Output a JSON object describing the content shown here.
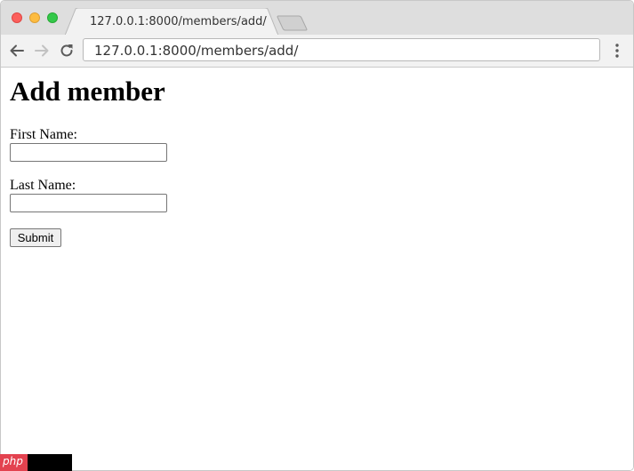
{
  "browser": {
    "tab_title": "127.0.0.1:8000/members/add/",
    "url": "127.0.0.1:8000/members/add/",
    "colors": {
      "close": "#fc605c",
      "minimize": "#fdbc40",
      "maximize": "#34c84a",
      "tabstrip": "#dedede",
      "toolbar": "#f2f2f2"
    },
    "icons": {
      "back": "arrow-left-icon",
      "forward": "arrow-right-icon",
      "reload": "reload-icon",
      "menu": "vertical-dots-icon",
      "new_tab": "new-tab-icon"
    }
  },
  "page": {
    "title": "Add member",
    "form": {
      "first_name_label": "First Name:",
      "first_name_value": "",
      "last_name_label": "Last Name:",
      "last_name_value": "",
      "submit_label": "Submit"
    }
  },
  "watermark": {
    "text": "php",
    "color": "#e3424f"
  }
}
